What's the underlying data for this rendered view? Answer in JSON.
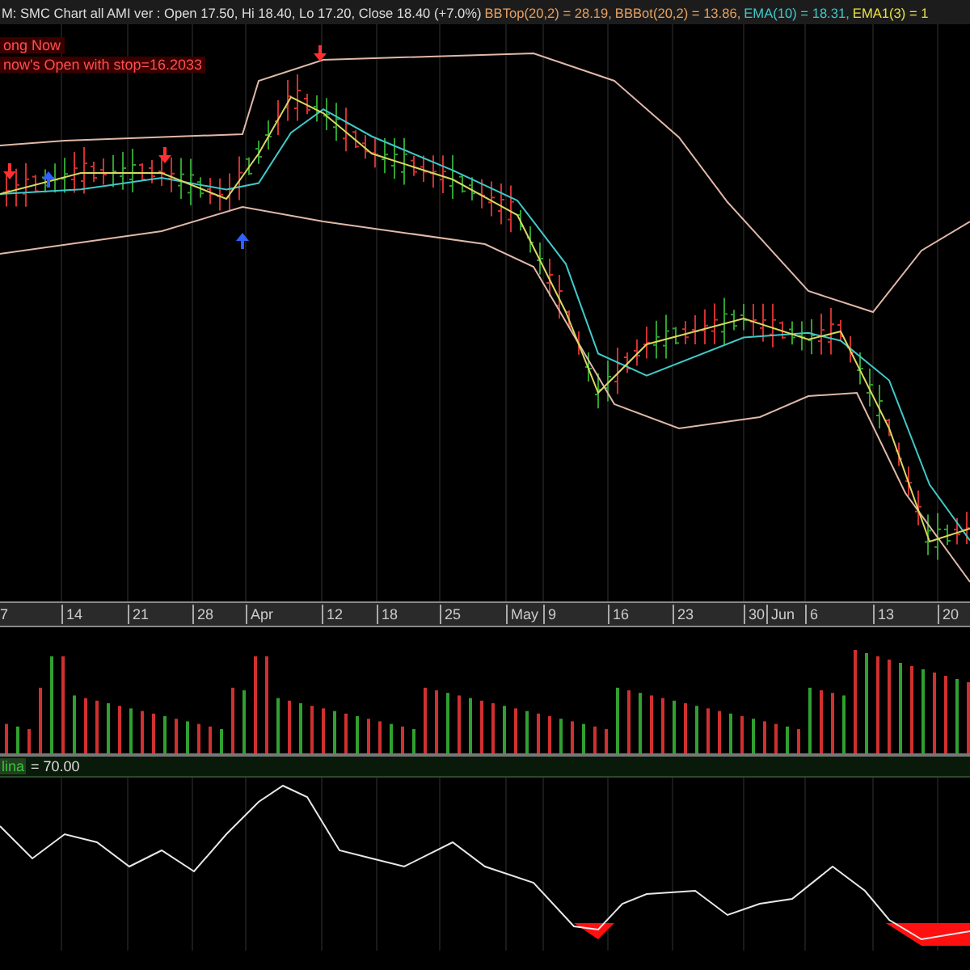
{
  "header": {
    "title": "M: SMC Chart all AMI ver : Open 17.50, Hi 18.40, Lo 17.20, Close 18.40 (+7.0%)",
    "indicators": [
      {
        "text": "BBTop(20,2) = 28.19,",
        "color": "#e8a060"
      },
      {
        "text": "BBBot(20,2) = 13.86,",
        "color": "#e8a060"
      },
      {
        "text": "EMA(10) = 18.31,",
        "color": "#40c8c8"
      },
      {
        "text": "EMA1(3) = 1",
        "color": "#e8e040"
      }
    ]
  },
  "signals": [
    "ong Now",
    "now's Open with stop=16.2033"
  ],
  "date_axis": [
    "7",
    "14",
    "21",
    "28",
    "Apr",
    "12",
    "18",
    "25",
    "May",
    "9",
    "16",
    "23",
    "30",
    "Jun",
    "6",
    "13",
    "20"
  ],
  "oscillator": {
    "label": "lina",
    "value": "= 70.00"
  }
}
